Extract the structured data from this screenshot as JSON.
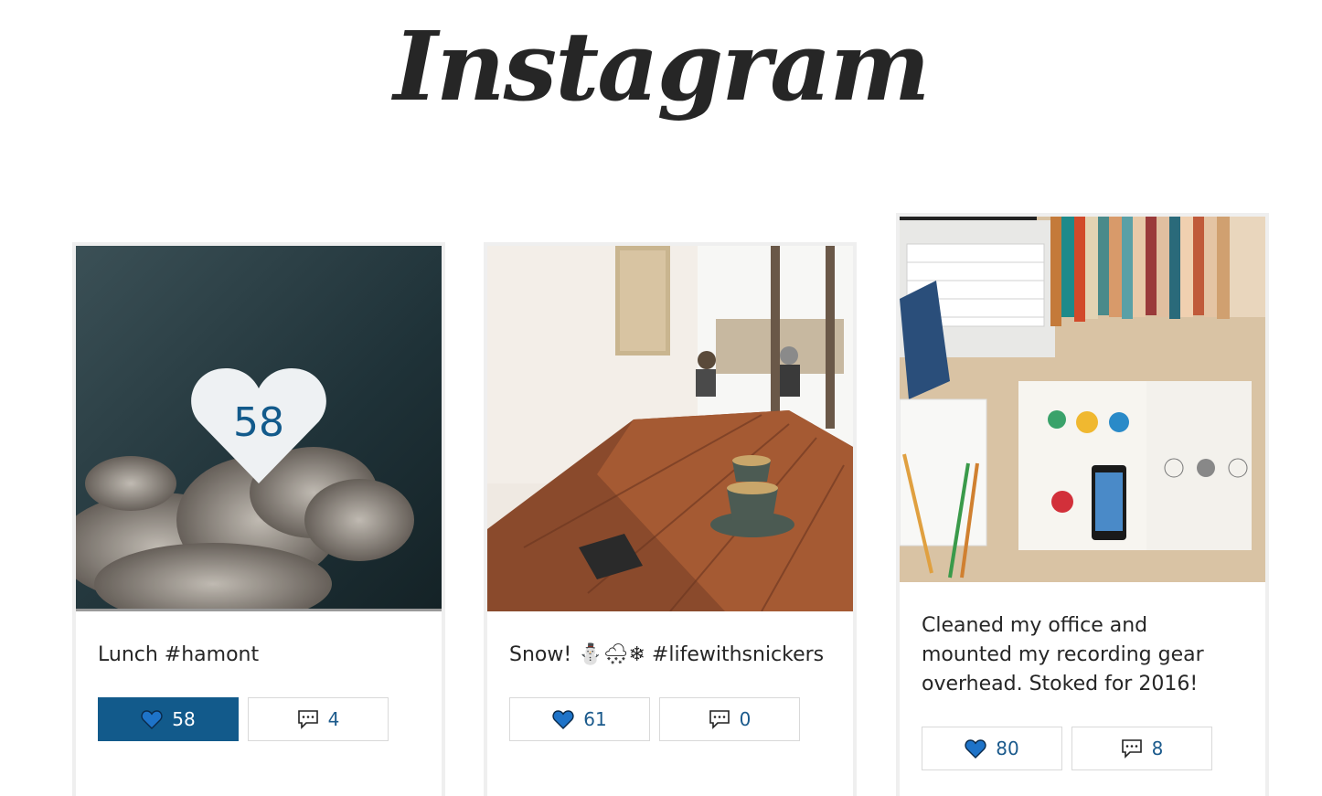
{
  "header": {
    "logo_text": "Instagram"
  },
  "posts": [
    {
      "caption": "Lunch #hamont",
      "likes": "58",
      "comments": "4",
      "liked": true,
      "overlay_likes": "58"
    },
    {
      "caption": "Snow! ⛄🌨❄ #lifewithsnickers",
      "likes": "61",
      "comments": "0",
      "liked": false
    },
    {
      "caption": "Cleaned my office and mounted my recording gear overhead. Stoked for 2016!",
      "likes": "80",
      "comments": "8",
      "liked": false
    }
  ],
  "icons": {
    "like": "heart-icon",
    "comment": "comment-icon"
  },
  "colors": {
    "accent": "#125a8b",
    "heart": "#1e73c8"
  }
}
